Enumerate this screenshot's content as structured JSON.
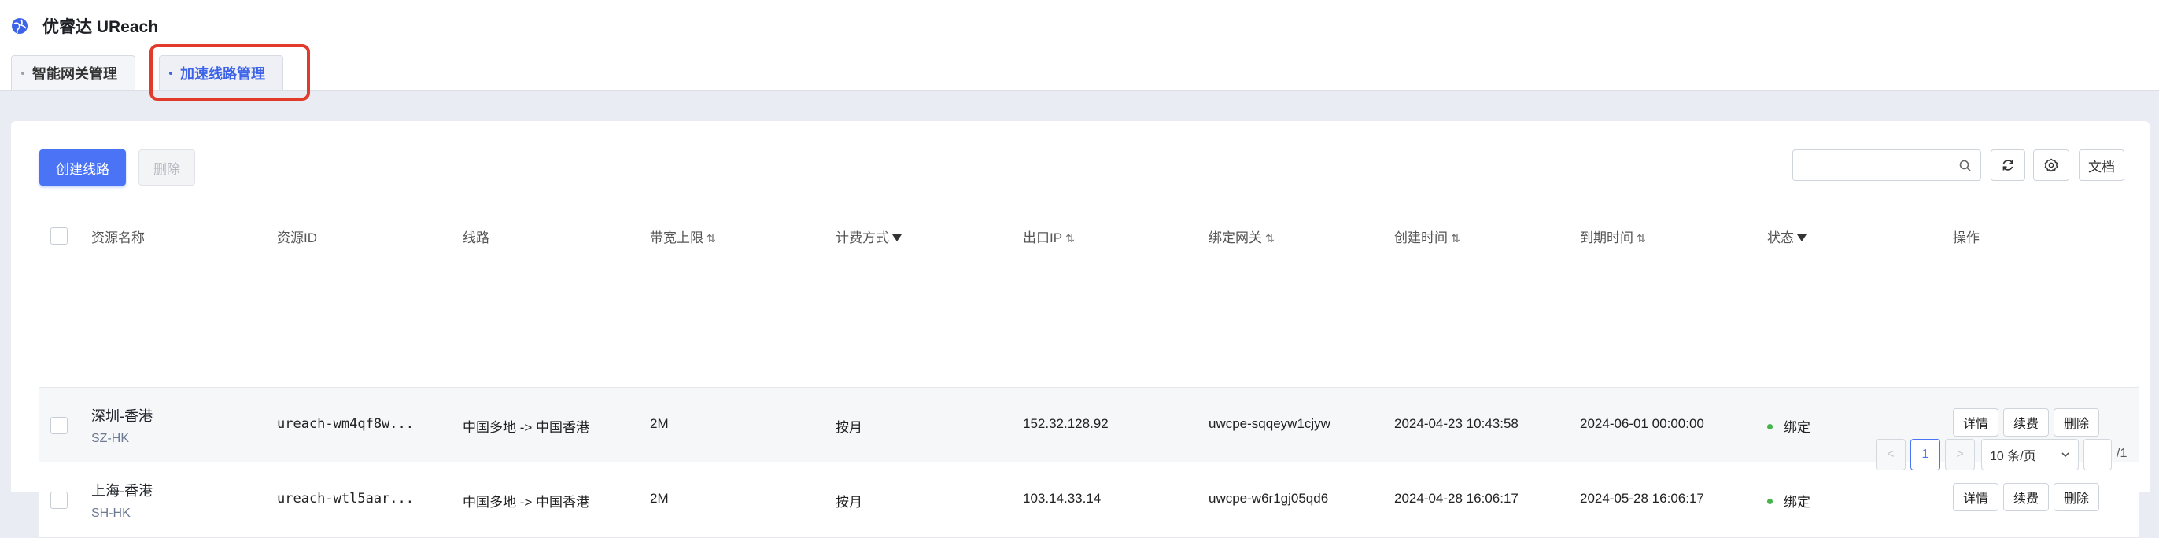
{
  "app": {
    "title": "优睿达 UReach"
  },
  "tabs": [
    {
      "label": "智能网关管理"
    },
    {
      "label": "加速线路管理"
    }
  ],
  "toolbar": {
    "create_label": "创建线路",
    "delete_label": "删除",
    "search_placeholder": "",
    "docs_label": "文档"
  },
  "table": {
    "columns": [
      "资源名称",
      "资源ID",
      "线路",
      "带宽上限",
      "计费方式",
      "出口IP",
      "绑定网关",
      "创建时间",
      "到期时间",
      "状态",
      "操作"
    ],
    "sort_icon": "⇅",
    "rows": [
      {
        "name": "深圳-香港",
        "code": "SZ-HK",
        "id": "ureach-wm4qf8w...",
        "route": "中国多地 -> 中国香港",
        "bandwidth": "2M",
        "billing": "按月",
        "ip": "152.32.128.92",
        "gateway": "uwcpe-sqqeyw1cjyw",
        "created": "2024-04-23 10:43:58",
        "expires": "2024-06-01 00:00:00",
        "status": "绑定",
        "actions": [
          "详情",
          "续费",
          "删除"
        ]
      },
      {
        "name": "上海-香港",
        "code": "SH-HK",
        "id": "ureach-wtl5aar...",
        "route": "中国多地 -> 中国香港",
        "bandwidth": "2M",
        "billing": "按月",
        "ip": "103.14.33.14",
        "gateway": "uwcpe-w6r1gj05qd6",
        "created": "2024-04-28 16:06:17",
        "expires": "2024-05-28 16:06:17",
        "status": "绑定",
        "actions": [
          "详情",
          "续费",
          "删除"
        ]
      }
    ]
  },
  "pagination": {
    "prev": "<",
    "current_page": "1",
    "next": ">",
    "page_size": "10 条/页",
    "jump_value": "",
    "total_pages": "/1"
  },
  "colors": {
    "accent": "#4a74f5",
    "highlight_border": "#e23a2b",
    "status_bound": "#44b549"
  }
}
